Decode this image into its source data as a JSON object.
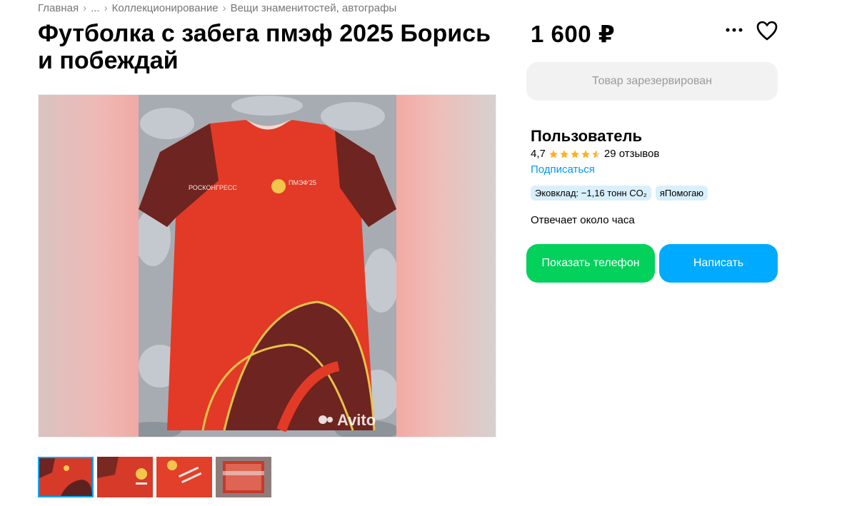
{
  "breadcrumbs": [
    "Главная",
    "...",
    "Коллекционирование",
    "Вещи знаменитостей, автографы"
  ],
  "title": "Футболка с забега пмэф 2025 Борись и побеждай",
  "price": "1 600 ₽",
  "reserved_label": "Товар зарезервирован",
  "seller": {
    "name": "Пользователь",
    "rating": "4,7",
    "stars": 4.5,
    "reviews": "29 отзывов",
    "subscribe": "Подписаться",
    "badges": [
      "Эковклад: −1,16 тонн CO₂",
      "яПомогаю"
    ],
    "response_time": "Отвечает около часа"
  },
  "buttons": {
    "phone": "Показать телефон",
    "message": "Написать"
  },
  "photo_texts": {
    "brand_left": "РОСКОНГРЕСС",
    "brand_right": "ПМЭФ'25",
    "watermark": "Avito"
  },
  "thumbnail_count": 4,
  "colors": {
    "accent_blue": "#00aaff",
    "phone_green": "#02d15c",
    "star": "#ffb021",
    "shirt_red": "#e23a26"
  }
}
